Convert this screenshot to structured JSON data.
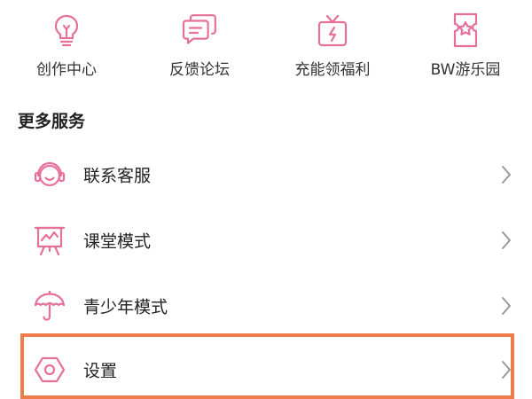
{
  "colors": {
    "accent": "#E7709A",
    "highlight": "#EF7D4C",
    "chevron": "#9A9A9A"
  },
  "top_grid": [
    {
      "label": "创作中心",
      "icon": "lightbulb-icon"
    },
    {
      "label": "反馈论坛",
      "icon": "chat-bubbles-icon"
    },
    {
      "label": "充能领福利",
      "icon": "gift-box-icon"
    },
    {
      "label": "BW游乐园",
      "icon": "ticket-star-icon"
    }
  ],
  "more_services": {
    "title": "更多服务",
    "items": [
      {
        "label": "联系客服",
        "icon": "headset-icon"
      },
      {
        "label": "课堂模式",
        "icon": "presentation-board-icon"
      },
      {
        "label": "青少年模式",
        "icon": "umbrella-icon"
      },
      {
        "label": "设置",
        "icon": "settings-hexagon-icon"
      }
    ]
  }
}
